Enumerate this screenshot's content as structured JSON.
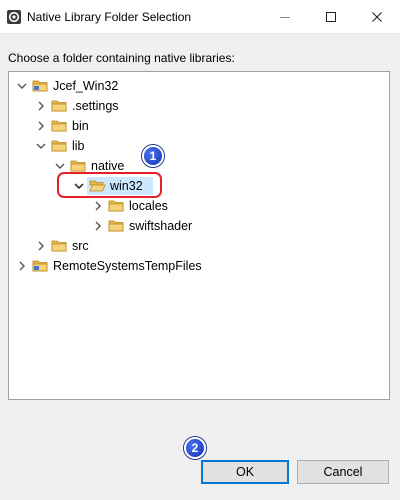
{
  "window": {
    "title": "Native Library Folder Selection",
    "icon": "eclipse-app-icon"
  },
  "prompt": "Choose a folder containing native libraries:",
  "tree": [
    {
      "label": "Jcef_Win32",
      "depth": 0,
      "expanded": true,
      "icon": "project-folder-icon"
    },
    {
      "label": ".settings",
      "depth": 1,
      "expanded": false,
      "icon": "folder-icon"
    },
    {
      "label": "bin",
      "depth": 1,
      "expanded": false,
      "icon": "folder-icon"
    },
    {
      "label": "lib",
      "depth": 1,
      "expanded": true,
      "icon": "folder-icon"
    },
    {
      "label": "native",
      "depth": 2,
      "expanded": true,
      "icon": "folder-icon"
    },
    {
      "label": "win32",
      "depth": 3,
      "expanded": true,
      "selected": true,
      "icon": "open-folder-icon"
    },
    {
      "label": "locales",
      "depth": 4,
      "expanded": false,
      "icon": "folder-icon"
    },
    {
      "label": "swiftshader",
      "depth": 4,
      "expanded": false,
      "icon": "folder-icon"
    },
    {
      "label": "src",
      "depth": 1,
      "expanded": false,
      "icon": "folder-icon"
    },
    {
      "label": "RemoteSystemsTempFiles",
      "depth": 0,
      "expanded": false,
      "icon": "project-folder-icon"
    }
  ],
  "annotations": {
    "step1": "1",
    "step2": "2",
    "highlight_color": "#e5202a",
    "badge_color": "#1f44c8"
  },
  "buttons": {
    "ok": "OK",
    "cancel": "Cancel"
  },
  "colors": {
    "selection": "#cce8ff",
    "folder": "#e8b84a",
    "default_button_border": "#0078d7"
  }
}
